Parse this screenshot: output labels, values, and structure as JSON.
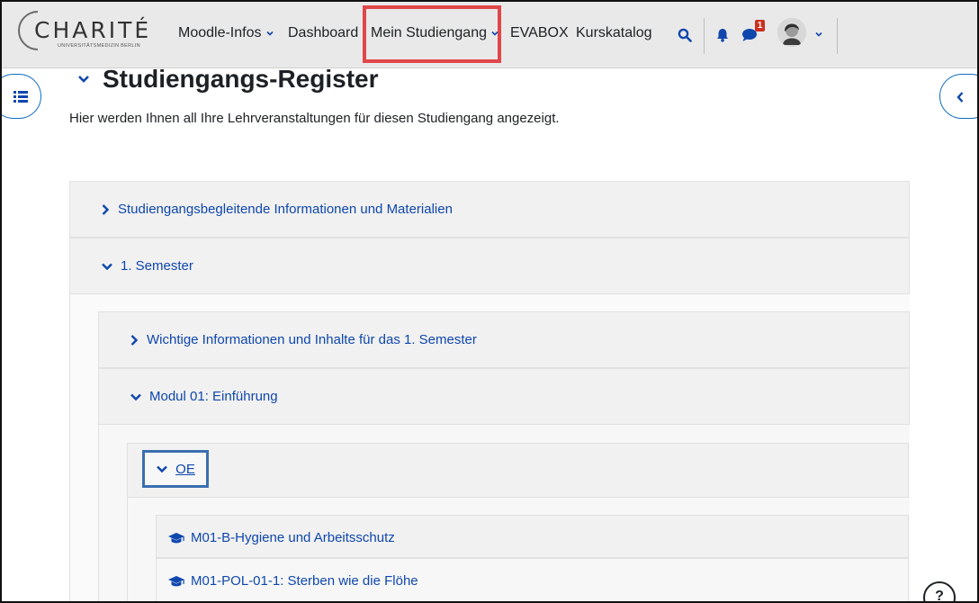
{
  "navbar": {
    "logo_text": "CHARITÉ",
    "logo_sub": "UNIVERSITÄTSMEDIZIN BERLIN",
    "items": [
      {
        "label": "Moodle-Infos",
        "dropdown": true
      },
      {
        "label": "Dashboard",
        "dropdown": false
      },
      {
        "label": "Mein Studiengang",
        "dropdown": true
      },
      {
        "label": "EVABOX",
        "dropdown": false
      },
      {
        "label": "Kurskatalog",
        "dropdown": false
      }
    ],
    "message_badge": "1",
    "icons": [
      "search-icon",
      "bell-icon",
      "chat-icon",
      "avatar",
      "chevron-down-icon"
    ]
  },
  "page": {
    "title": "Studiengangs-Register",
    "intro": "Hier werden Ihnen all Ihre Lehrveranstaltungen für diesen Studiengang angezeigt."
  },
  "tree": {
    "info_label": "Studiengangsbegleitende Informationen und Materialien",
    "semester_label": "1. Semester",
    "wichtige_label": "Wichtige Informationen und Inhalte für das 1. Semester",
    "modul_label": "Modul 01: Einführung",
    "oe_label": "OE",
    "courses": [
      "M01-B-Hygiene und Arbeitsschutz",
      "M01-POL-01-1: Sterben wie die Flöhe"
    ]
  },
  "help_label": "?",
  "colors": {
    "link": "#0f47ad",
    "accent": "#0f6cbf",
    "highlight": "#e0474a",
    "navbar_bg": "#e9e9e9"
  }
}
